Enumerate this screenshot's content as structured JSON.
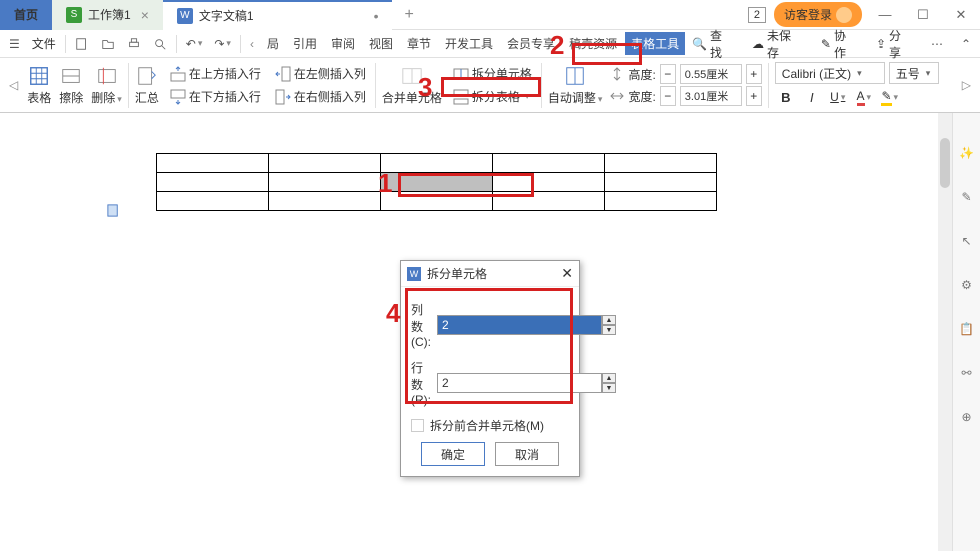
{
  "tabs": {
    "home": "首页",
    "sheet": "工作簿1",
    "doc": "文字文稿1"
  },
  "titleRight": {
    "badge": "2",
    "login": "访客登录"
  },
  "menubar": {
    "file": "文件",
    "nav": [
      "局",
      "引用",
      "审阅",
      "视图",
      "章节",
      "开发工具",
      "会员专享",
      "稿壳资源",
      "表格工具"
    ],
    "search": "查找",
    "unsaved": "未保存",
    "collab": "协作",
    "share": "分享"
  },
  "ribbon": {
    "table": "表格",
    "erase": "擦除",
    "delete": "删除",
    "summary": "汇总",
    "insAbove": "在上方插入行",
    "insBelow": "在下方插入行",
    "insLeft": "在左侧插入列",
    "insRight": "在右侧插入列",
    "merge": "合并单元格",
    "splitCell": "拆分单元格",
    "splitTable": "拆分表格",
    "autoFit": "自动调整",
    "heightLbl": "高度:",
    "heightVal": "0.55厘米",
    "widthLbl": "宽度:",
    "widthVal": "3.01厘米",
    "font": "Calibri (正文)",
    "size": "五号",
    "bold": "B",
    "italic": "I",
    "underline": "U"
  },
  "dialog": {
    "title": "拆分单元格",
    "cols": "列数(C):",
    "colsVal": "2",
    "rows": "行数(R):",
    "rowsVal": "2",
    "mergeBefore": "拆分前合并单元格(M)",
    "ok": "确定",
    "cancel": "取消"
  },
  "anno": {
    "n1": "1",
    "n2": "2",
    "n3": "3",
    "n4": "4"
  }
}
